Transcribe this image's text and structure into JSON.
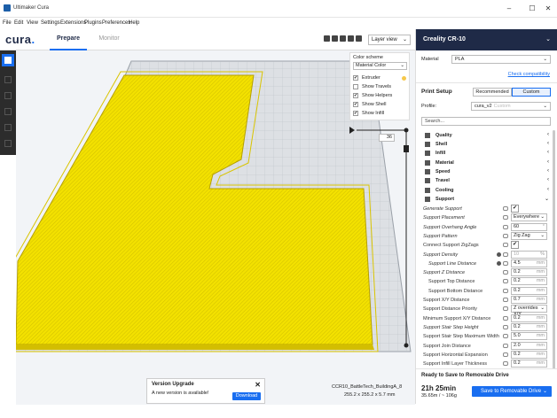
{
  "window": {
    "title": "Ultimaker Cura",
    "minimize": "–",
    "maximize": "☐",
    "close": "✕"
  },
  "menu": [
    "File",
    "Edit",
    "View",
    "Settings",
    "Extensions",
    "Plugins",
    "Preferences",
    "Help"
  ],
  "header": {
    "logo": "cura",
    "logo_dot": ".",
    "tab_prepare": "Prepare",
    "tab_monitor": "Monitor",
    "view_mode": "Layer view"
  },
  "color_scheme": {
    "label": "Color scheme",
    "selected": "Material Color",
    "options": [
      {
        "label": "Extruder",
        "checked": true,
        "swatch": "#f6c84b"
      },
      {
        "label": "Show Travels",
        "checked": false
      },
      {
        "label": "Show Helpers",
        "checked": true
      },
      {
        "label": "Show Shell",
        "checked": true
      },
      {
        "label": "Show Infill",
        "checked": true
      }
    ]
  },
  "layer": {
    "current": "36"
  },
  "upgrade": {
    "title": "Version Upgrade",
    "text": "A new version is available!",
    "button": "Download"
  },
  "model": {
    "name": "CCR10_BattleTech_BuildingA_8",
    "dims": "255.2 x 255.2 x 5.7 mm"
  },
  "sidebar": {
    "printer": "Creality CR-10",
    "material_label": "Material",
    "material": "PLA",
    "compat": "Check compatibility",
    "print_setup": "Print Setup",
    "recommended": "Recommended",
    "custom": "Custom",
    "profile_label": "Profile:",
    "profile": "cura_v2",
    "profile_sub": "Custom",
    "search_placeholder": "Search...",
    "categories": [
      "Quality",
      "Shell",
      "Infill",
      "Material",
      "Speed",
      "Travel",
      "Cooling",
      "Support"
    ],
    "settings": [
      {
        "label": "Generate Support",
        "italic": true,
        "indent": 0,
        "type": "check",
        "value": "✔"
      },
      {
        "label": "Support Placement",
        "italic": true,
        "indent": 0,
        "type": "select",
        "value": "Everywhere"
      },
      {
        "label": "Support Overhang Angle",
        "italic": true,
        "indent": 0,
        "type": "num",
        "value": "60",
        "unit": "°"
      },
      {
        "label": "Support Pattern",
        "italic": true,
        "indent": 0,
        "type": "select",
        "value": "Zig Zag"
      },
      {
        "label": "Connect Support ZigZags",
        "italic": false,
        "indent": 0,
        "type": "check",
        "value": "✔"
      },
      {
        "label": "Support Density",
        "italic": true,
        "indent": 0,
        "type": "num",
        "value": "10",
        "unit": "%",
        "disabled": true,
        "info": true
      },
      {
        "label": "Support Line Distance",
        "italic": true,
        "indent": 6,
        "type": "num",
        "value": "4.5",
        "unit": "mm",
        "info": true
      },
      {
        "label": "Support Z Distance",
        "italic": true,
        "indent": 0,
        "type": "num",
        "value": "0.2",
        "unit": "mm"
      },
      {
        "label": "Support Top Distance",
        "italic": false,
        "indent": 6,
        "type": "num",
        "value": "0.2",
        "unit": "mm"
      },
      {
        "label": "Support Bottom Distance",
        "italic": false,
        "indent": 6,
        "type": "num",
        "value": "0.2",
        "unit": "mm"
      },
      {
        "label": "Support X/Y Distance",
        "italic": false,
        "indent": 0,
        "type": "num",
        "value": "0.7",
        "unit": "mm"
      },
      {
        "label": "Support Distance Priority",
        "italic": false,
        "indent": 0,
        "type": "select",
        "value": "Z overrides X/Y"
      },
      {
        "label": "Minimum Support X/Y Distance",
        "italic": false,
        "indent": 0,
        "type": "num",
        "value": "0.2",
        "unit": "mm"
      },
      {
        "label": "Support Stair Step Height",
        "italic": true,
        "indent": 0,
        "type": "num",
        "value": "0.2",
        "unit": "mm"
      },
      {
        "label": "Support Stair Step Maximum Width",
        "italic": false,
        "indent": 0,
        "type": "num",
        "value": "5.0",
        "unit": "mm"
      },
      {
        "label": "Support Join Distance",
        "italic": false,
        "indent": 0,
        "type": "num",
        "value": "2.0",
        "unit": "mm"
      },
      {
        "label": "Support Horizontal Expansion",
        "italic": false,
        "indent": 0,
        "type": "num",
        "value": "0.2",
        "unit": "mm"
      },
      {
        "label": "Support Infill Layer Thickness",
        "italic": false,
        "indent": 0,
        "type": "num",
        "value": "0.2",
        "unit": "mm"
      }
    ],
    "ready": "Ready to Save to Removable Drive",
    "time": "21h 25min",
    "usage": "35.65m / ~ 106g",
    "save_button": "Save to Removable Drive"
  },
  "colors": {
    "accent": "#196ef0",
    "header_dark": "#1f2a47",
    "print_yellow": "#f3e100",
    "plate": "#eaeaea"
  }
}
